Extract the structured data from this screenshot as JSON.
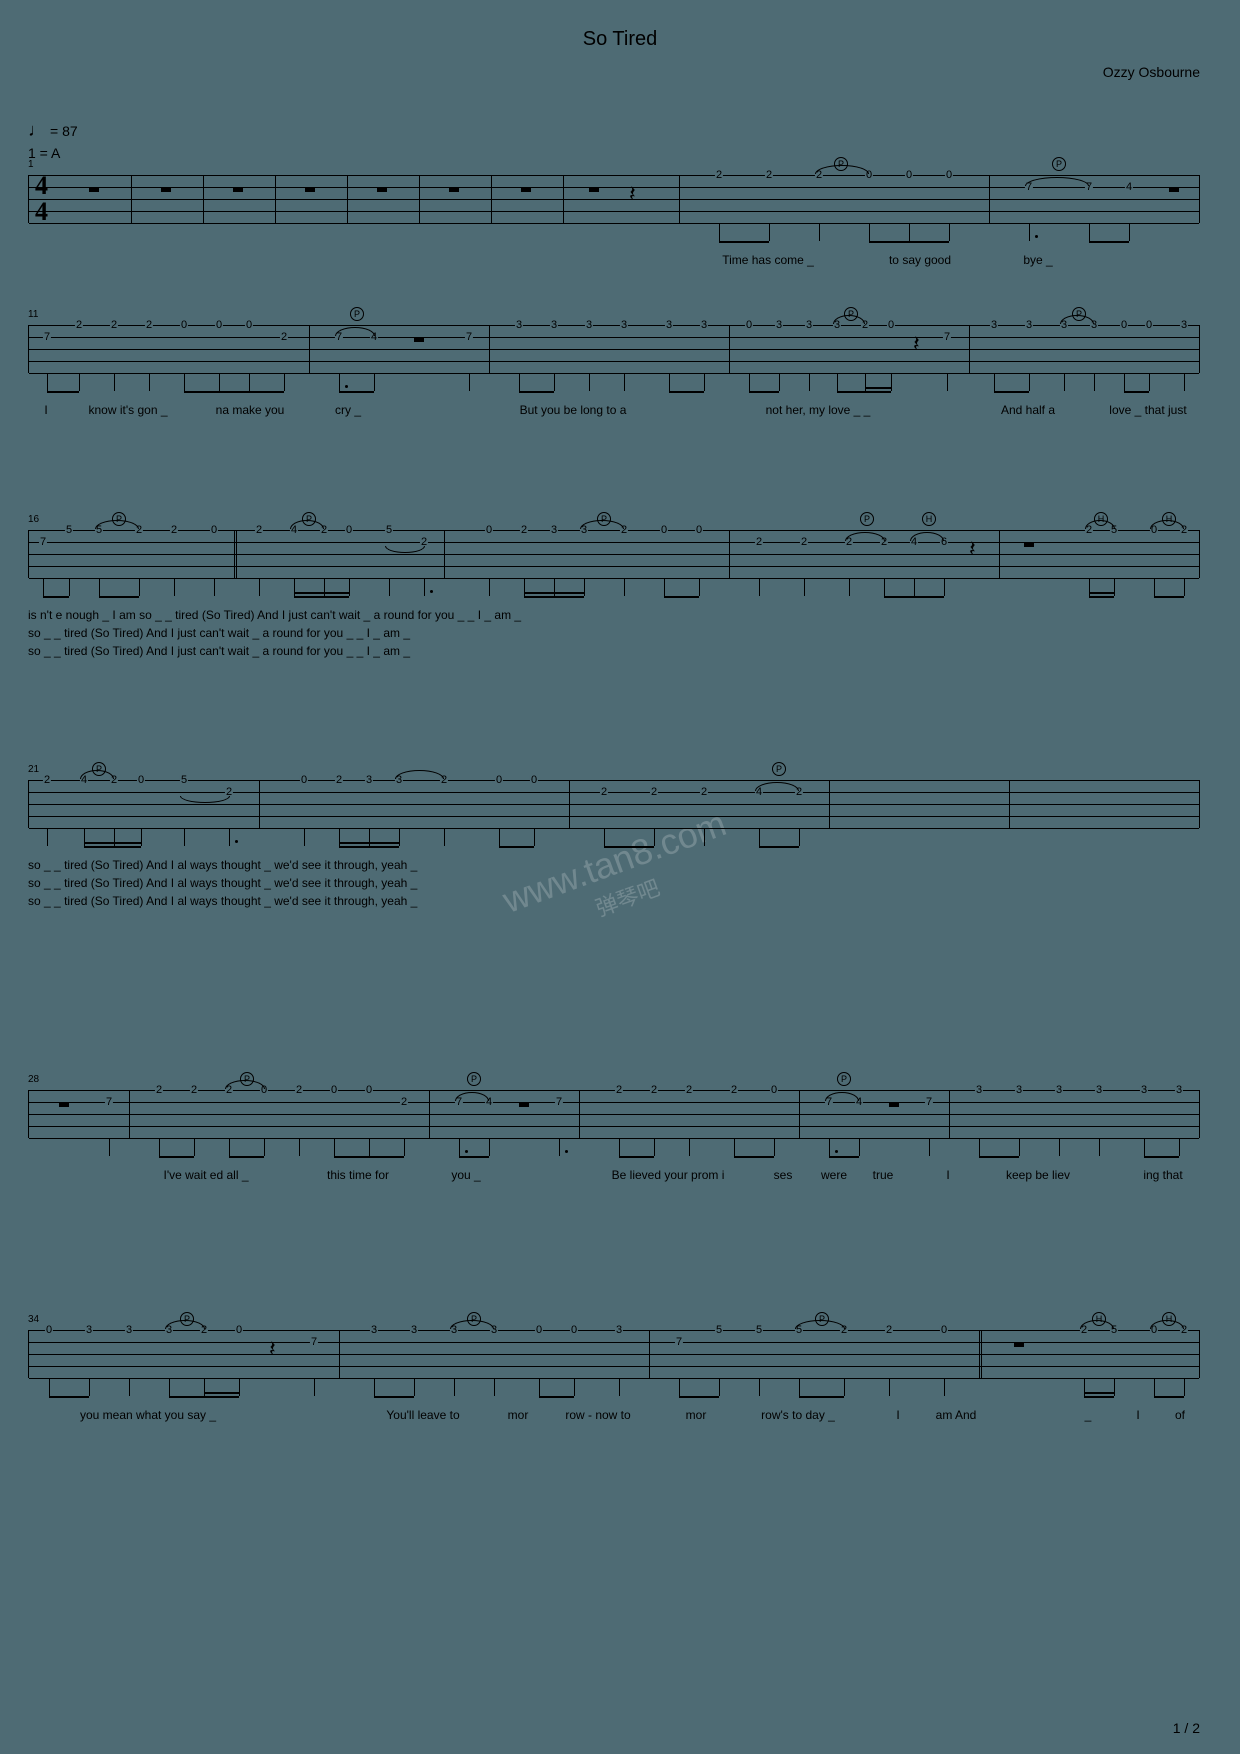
{
  "title": "So Tired",
  "composer": "Ozzy Osbourne",
  "tempo": "= 87",
  "key": "1 = A",
  "page": "1 / 2",
  "watermark": {
    "main": "www.tan8.com",
    "sub": "弹琴吧"
  },
  "timesig": {
    "top": "4",
    "bottom": "4"
  },
  "bars": {
    "b1": "1",
    "b2": "11",
    "b3": "16",
    "b4": "21",
    "b5": "28",
    "b6": "34"
  },
  "tech": {
    "P": "P",
    "H": "H"
  },
  "chart_data": {
    "type": "tablature",
    "tuning_strings": 4,
    "systems": [
      {
        "bar_start": 1,
        "measures": [
          {
            "notes": [
              "rest"
            ]
          },
          {
            "notes": [
              "rest"
            ]
          },
          {
            "notes": [
              "rest"
            ]
          },
          {
            "notes": [
              "rest"
            ]
          },
          {
            "notes": [
              "rest"
            ]
          },
          {
            "notes": [
              "rest"
            ]
          },
          {
            "notes": [
              "rest"
            ]
          },
          {
            "notes": [
              "rest",
              "qrest"
            ]
          },
          {
            "notes": [
              {
                "s": 1,
                "f": 2
              },
              {
                "s": 1,
                "f": 2
              },
              {
                "s": 1,
                "f": 2
              },
              {
                "s": 1,
                "f": 0
              },
              {
                "s": 1,
                "f": 0
              },
              {
                "s": 1,
                "f": 0
              }
            ]
          },
          {
            "notes": [
              {
                "s": 2,
                "f": 7,
                "tech": "P"
              },
              {
                "s": 2,
                "f": 7
              },
              {
                "s": 2,
                "f": 4
              },
              "rest"
            ]
          }
        ],
        "lyrics": [
          [
            "Time has come _",
            "to say good",
            "bye _"
          ]
        ]
      },
      {
        "bar_start": 11,
        "measures": [
          {
            "notes": [
              {
                "s": 2,
                "f": 7
              },
              {
                "s": 1,
                "f": 2
              },
              {
                "s": 1,
                "f": 2
              },
              {
                "s": 1,
                "f": 2
              },
              {
                "s": 1,
                "f": 0
              },
              {
                "s": 1,
                "f": 0
              },
              {
                "s": 1,
                "f": 0
              },
              {
                "s": 2,
                "f": 2
              }
            ]
          },
          {
            "notes": [
              {
                "s": 2,
                "f": 7,
                "tech": "P"
              },
              {
                "s": 2,
                "f": 4
              },
              "rest",
              {
                "s": 2,
                "f": 7
              }
            ]
          },
          {
            "notes": [
              {
                "s": 1,
                "f": 3
              },
              {
                "s": 1,
                "f": 3
              },
              {
                "s": 1,
                "f": 3
              },
              {
                "s": 1,
                "f": 3
              },
              {
                "s": 1,
                "f": 3
              },
              {
                "s": 1,
                "f": 3
              }
            ]
          },
          {
            "notes": [
              {
                "s": 1,
                "f": 0
              },
              {
                "s": 1,
                "f": 3
              },
              {
                "s": 1,
                "f": 3
              },
              {
                "s": 1,
                "f": 3
              },
              {
                "s": 1,
                "f": 2,
                "tech": "P"
              },
              {
                "s": 1,
                "f": 0
              },
              "qrest",
              {
                "s": 2,
                "f": 7
              }
            ]
          },
          {
            "notes": [
              {
                "s": 1,
                "f": 3
              },
              {
                "s": 1,
                "f": 3
              },
              {
                "s": 1,
                "f": 3
              },
              {
                "s": 1,
                "f": 3,
                "tech": "P"
              },
              {
                "s": 1,
                "f": 0
              },
              {
                "s": 1,
                "f": 0
              },
              {
                "s": 1,
                "f": 3
              }
            ]
          }
        ],
        "lyrics": [
          [
            "I",
            "know it's gon _",
            "na make you",
            "cry _",
            "",
            "But you be long  to a",
            "not her, my  love _  _",
            "",
            "And half a",
            "love _  that  just"
          ]
        ]
      },
      {
        "bar_start": 16,
        "measures": [
          {
            "notes": [
              {
                "s": 2,
                "f": 7
              },
              {
                "s": 1,
                "f": 5
              },
              {
                "s": 1,
                "f": 5,
                "tech": "P"
              },
              {
                "s": 1,
                "f": 2
              },
              {
                "s": 1,
                "f": 2
              },
              {
                "s": 1,
                "f": 0
              }
            ]
          },
          {
            "notes": [
              {
                "s": 1,
                "f": 2
              },
              {
                "s": 1,
                "f": 4,
                "tech": "P"
              },
              {
                "s": 1,
                "f": 2
              },
              {
                "s": 1,
                "f": 0
              },
              {
                "s": 1,
                "f": 5
              },
              {
                "s": 2,
                "f": 2
              }
            ]
          },
          {
            "notes": [
              {
                "s": 1,
                "f": 0
              },
              {
                "s": 1,
                "f": 2
              },
              {
                "s": 1,
                "f": 3
              },
              {
                "s": 1,
                "f": 3
              },
              {
                "s": 1,
                "f": 2,
                "tech": "P"
              },
              {
                "s": 1,
                "f": 0
              },
              {
                "s": 1,
                "f": 0
              }
            ]
          },
          {
            "notes": [
              {
                "s": 2,
                "f": 2
              },
              {
                "s": 2,
                "f": 2
              },
              {
                "s": 2,
                "f": 2
              },
              {
                "s": 2,
                "f": 2,
                "tech": "P"
              },
              {
                "s": 2,
                "f": 4
              },
              {
                "s": 2,
                "f": 6
              },
              "qrest"
            ]
          },
          {
            "notes": [
              "rest",
              {
                "s": 1,
                "f": 2,
                "tech": "H"
              },
              {
                "s": 1,
                "f": 5
              },
              {
                "s": 1,
                "f": 0,
                "tech": "H"
              },
              {
                "s": 1,
                "f": 2
              }
            ]
          }
        ],
        "lyrics": [
          [
            "is n't e nough _",
            "I",
            "am",
            "so",
            "_  _",
            "tired  (So Tired)",
            "",
            "And I",
            "just can't wait _",
            "a",
            "round for you",
            "_  _",
            "",
            "I",
            "_",
            "am _"
          ],
          [
            "",
            "",
            "",
            "so",
            "_  _",
            "tired  (So Tired)",
            "",
            "And I",
            "just can't wait _",
            "a",
            "round for you",
            "_  _",
            "",
            "I",
            "_",
            "am _"
          ],
          [
            "",
            "",
            "",
            "so",
            "_  _",
            "tired  (So Tired)",
            "",
            "And I",
            "just can't wait _",
            "a",
            "round for you",
            "_  _",
            "",
            "I",
            "_",
            "am _"
          ]
        ]
      },
      {
        "bar_start": 21,
        "measures": [
          {
            "notes": [
              {
                "s": 1,
                "f": 2
              },
              {
                "s": 1,
                "f": 4,
                "tech": "P"
              },
              {
                "s": 1,
                "f": 2
              },
              {
                "s": 1,
                "f": 0
              },
              {
                "s": 1,
                "f": 5
              },
              {
                "s": 2,
                "f": 2
              }
            ]
          },
          {
            "notes": [
              {
                "s": 1,
                "f": 0
              },
              {
                "s": 1,
                "f": 2
              },
              {
                "s": 1,
                "f": 3
              },
              {
                "s": 1,
                "f": 3
              },
              {
                "s": 1,
                "f": 2
              },
              {
                "s": 1,
                "f": 0
              },
              {
                "s": 1,
                "f": 0
              }
            ]
          },
          {
            "notes": [
              {
                "s": 2,
                "f": 2
              },
              {
                "s": 2,
                "f": 2
              },
              {
                "s": 2,
                "f": 2
              },
              {
                "s": 2,
                "f": 4,
                "tech": "P"
              },
              {
                "s": 2,
                "f": 2
              }
            ]
          },
          {
            "notes": []
          },
          {
            "notes": []
          }
        ],
        "lyrics": [
          [
            "so",
            "_  _",
            "tired  (So Tired)",
            "",
            "And I",
            "al ways thought _",
            "we'd",
            "see it",
            "through, yeah _"
          ],
          [
            "so",
            "_  _",
            "tired  (So Tired)",
            "",
            "And I",
            "al ways thought _",
            "we'd",
            "see it",
            "through, yeah _"
          ],
          [
            "so",
            "_  _",
            "tired  (So Tired)",
            "",
            "And I",
            "al ways thought _",
            "we'd",
            "see it",
            "through, yeah _"
          ]
        ]
      },
      {
        "bar_start": 28,
        "measures": [
          {
            "notes": [
              "rest",
              {
                "s": 2,
                "f": 7
              }
            ]
          },
          {
            "notes": [
              {
                "s": 1,
                "f": 2
              },
              {
                "s": 1,
                "f": 2
              },
              {
                "s": 1,
                "f": 2,
                "tech": "P"
              },
              {
                "s": 1,
                "f": 0
              },
              {
                "s": 1,
                "f": 2
              },
              {
                "s": 1,
                "f": 0
              },
              {
                "s": 1,
                "f": 0
              },
              {
                "s": 2,
                "f": 2
              }
            ]
          },
          {
            "notes": [
              {
                "s": 2,
                "f": 7,
                "tech": "P"
              },
              {
                "s": 2,
                "f": 4
              },
              "rest",
              {
                "s": 2,
                "f": 7
              }
            ]
          },
          {
            "notes": [
              {
                "s": 1,
                "f": 2
              },
              {
                "s": 1,
                "f": 2
              },
              {
                "s": 1,
                "f": 2
              },
              {
                "s": 1,
                "f": 2
              },
              {
                "s": 1,
                "f": 0
              }
            ]
          },
          {
            "notes": [
              {
                "s": 2,
                "f": 7,
                "tech": "P"
              },
              {
                "s": 2,
                "f": 4
              },
              "rest",
              {
                "s": 2,
                "f": 7
              }
            ]
          },
          {
            "notes": [
              {
                "s": 1,
                "f": 3
              },
              {
                "s": 1,
                "f": 3
              },
              {
                "s": 1,
                "f": 3
              },
              {
                "s": 1,
                "f": 3
              },
              {
                "s": 1,
                "f": 3
              },
              {
                "s": 1,
                "f": 3
              }
            ]
          }
        ],
        "lyrics": [
          [
            "",
            "I've wait ed all _",
            "this time for",
            "you _",
            "",
            "Be lieved your prom i",
            "ses",
            "were",
            "true",
            "",
            "I",
            "keep be liev",
            "ing that"
          ]
        ]
      },
      {
        "bar_start": 34,
        "measures": [
          {
            "notes": [
              {
                "s": 1,
                "f": 0
              },
              {
                "s": 1,
                "f": 3
              },
              {
                "s": 1,
                "f": 3
              },
              {
                "s": 1,
                "f": 3,
                "tech": "P"
              },
              {
                "s": 1,
                "f": 2
              },
              {
                "s": 1,
                "f": 0
              },
              "qrest",
              {
                "s": 2,
                "f": 7
              }
            ]
          },
          {
            "notes": [
              {
                "s": 1,
                "f": 3
              },
              {
                "s": 1,
                "f": 3
              },
              {
                "s": 1,
                "f": 3
              },
              {
                "s": 1,
                "f": 3,
                "tech": "P"
              },
              {
                "s": 1,
                "f": 0
              },
              {
                "s": 1,
                "f": 0
              },
              {
                "s": 1,
                "f": 3
              }
            ]
          },
          {
            "notes": [
              {
                "s": 2,
                "f": 7
              },
              {
                "s": 1,
                "f": 5
              },
              {
                "s": 1,
                "f": 5
              },
              {
                "s": 1,
                "f": 5,
                "tech": "P"
              },
              {
                "s": 1,
                "f": 2
              },
              {
                "s": 1,
                "f": 2
              },
              {
                "s": 1,
                "f": 0
              }
            ]
          },
          {
            "notes": [
              "rest",
              {
                "s": 1,
                "f": 2,
                "tech": "H"
              },
              {
                "s": 1,
                "f": 5
              },
              {
                "s": 1,
                "f": 0,
                "tech": "H"
              },
              {
                "s": 1,
                "f": 2
              }
            ]
          }
        ],
        "lyrics": [
          [
            "you mean what you say _",
            "",
            "",
            "You'll leave to",
            "mor",
            "row - now to",
            "mor",
            "row's to day _",
            "I",
            "am And",
            "",
            "_",
            "I",
            "of"
          ]
        ]
      }
    ]
  }
}
